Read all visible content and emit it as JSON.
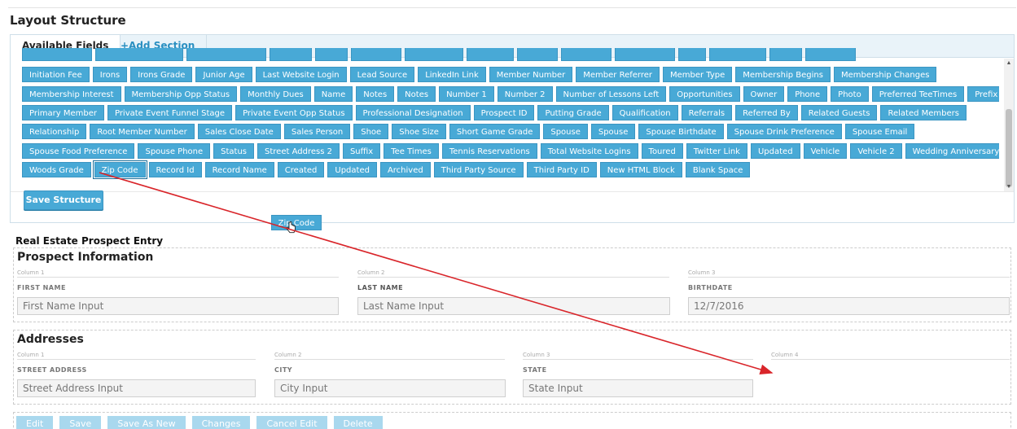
{
  "page": {
    "title": "Layout Structure"
  },
  "tabs": [
    {
      "label": "Available Fields"
    },
    {
      "label": "+Add Section"
    }
  ],
  "chip_rows": [
    [
      "Initiation Fee",
      "Irons",
      "Irons Grade",
      "Junior Age",
      "Last Website Login",
      "Lead Source",
      "LinkedIn Link",
      "Member Number",
      "Member Referrer",
      "Member Type",
      "Membership Begins",
      "Membership Changes"
    ],
    [
      "Membership Interest",
      "Membership Opp Status",
      "Monthly Dues",
      "Name",
      "Notes",
      "Notes",
      "Number 1",
      "Number 2",
      "Number of Lessons Left",
      "Opportunities",
      "Owner",
      "Phone",
      "Photo",
      "Preferred TeeTimes",
      "Prefix"
    ],
    [
      "Primary Member",
      "Private Event Funnel Stage",
      "Private Event Opp Status",
      "Professional Designation",
      "Prospect ID",
      "Putting Grade",
      "Qualification",
      "Referrals",
      "Referred By",
      "Related Guests",
      "Related Members"
    ],
    [
      "Relationship",
      "Root Member Number",
      "Sales Close Date",
      "Sales Person",
      "Shoe",
      "Shoe Size",
      "Short Game Grade",
      "Spouse",
      "Spouse",
      "Spouse Birthdate",
      "Spouse Drink Preference",
      "Spouse Email"
    ],
    [
      "Spouse Food Preference",
      "Spouse Phone",
      "Status",
      "Street Address 2",
      "Suffix",
      "Tee Times",
      "Tennis Reservations",
      "Total Website Logins",
      "Toured",
      "Twitter Link",
      "Updated",
      "Vehicle",
      "Vehicle 2",
      "Wedding Anniversary"
    ],
    [
      "Woods Grade",
      "Zip Code",
      "Record Id",
      "Record Name",
      "Created",
      "Updated",
      "Archived",
      "Third Party Source",
      "Third Party ID",
      "New HTML Block",
      "Blank Space"
    ]
  ],
  "save_structure_label": "Save Structure",
  "dragging_chip": "Zip Code",
  "form": {
    "title": "Real Estate Prospect Entry",
    "sections": [
      {
        "title": "Prospect Information",
        "columns": [
          {
            "col_label": "Column 1",
            "field_label": "FIRST NAME",
            "placeholder": "First Name Input"
          },
          {
            "col_label": "Column 2",
            "field_label": "LAST NAME",
            "placeholder": "Last Name Input"
          },
          {
            "col_label": "Column 3",
            "field_label": "BIRTHDATE",
            "value": "12/7/2016"
          }
        ]
      },
      {
        "title": "Addresses",
        "columns": [
          {
            "col_label": "Column 1",
            "field_label": "STREET ADDRESS",
            "placeholder": "Street Address Input"
          },
          {
            "col_label": "Column 2",
            "field_label": "CITY",
            "placeholder": "City Input"
          },
          {
            "col_label": "Column 3",
            "field_label": "STATE",
            "placeholder": "State Input"
          },
          {
            "col_label": "Column 4"
          }
        ]
      }
    ],
    "buttons": [
      "Edit",
      "Save",
      "Save As New",
      "Changes",
      "Cancel Edit",
      "Delete"
    ]
  },
  "colors": {
    "chip": "#48a9d6",
    "accent": "#2a8fc1",
    "annotation_arrow": "#d9252a",
    "disabled_button": "#a9d8ee"
  },
  "icons": {
    "cursor": "hand-pointer-icon",
    "scroll_up": "scroll-up-arrow-icon",
    "scroll_down": "scroll-down-arrow-icon"
  }
}
